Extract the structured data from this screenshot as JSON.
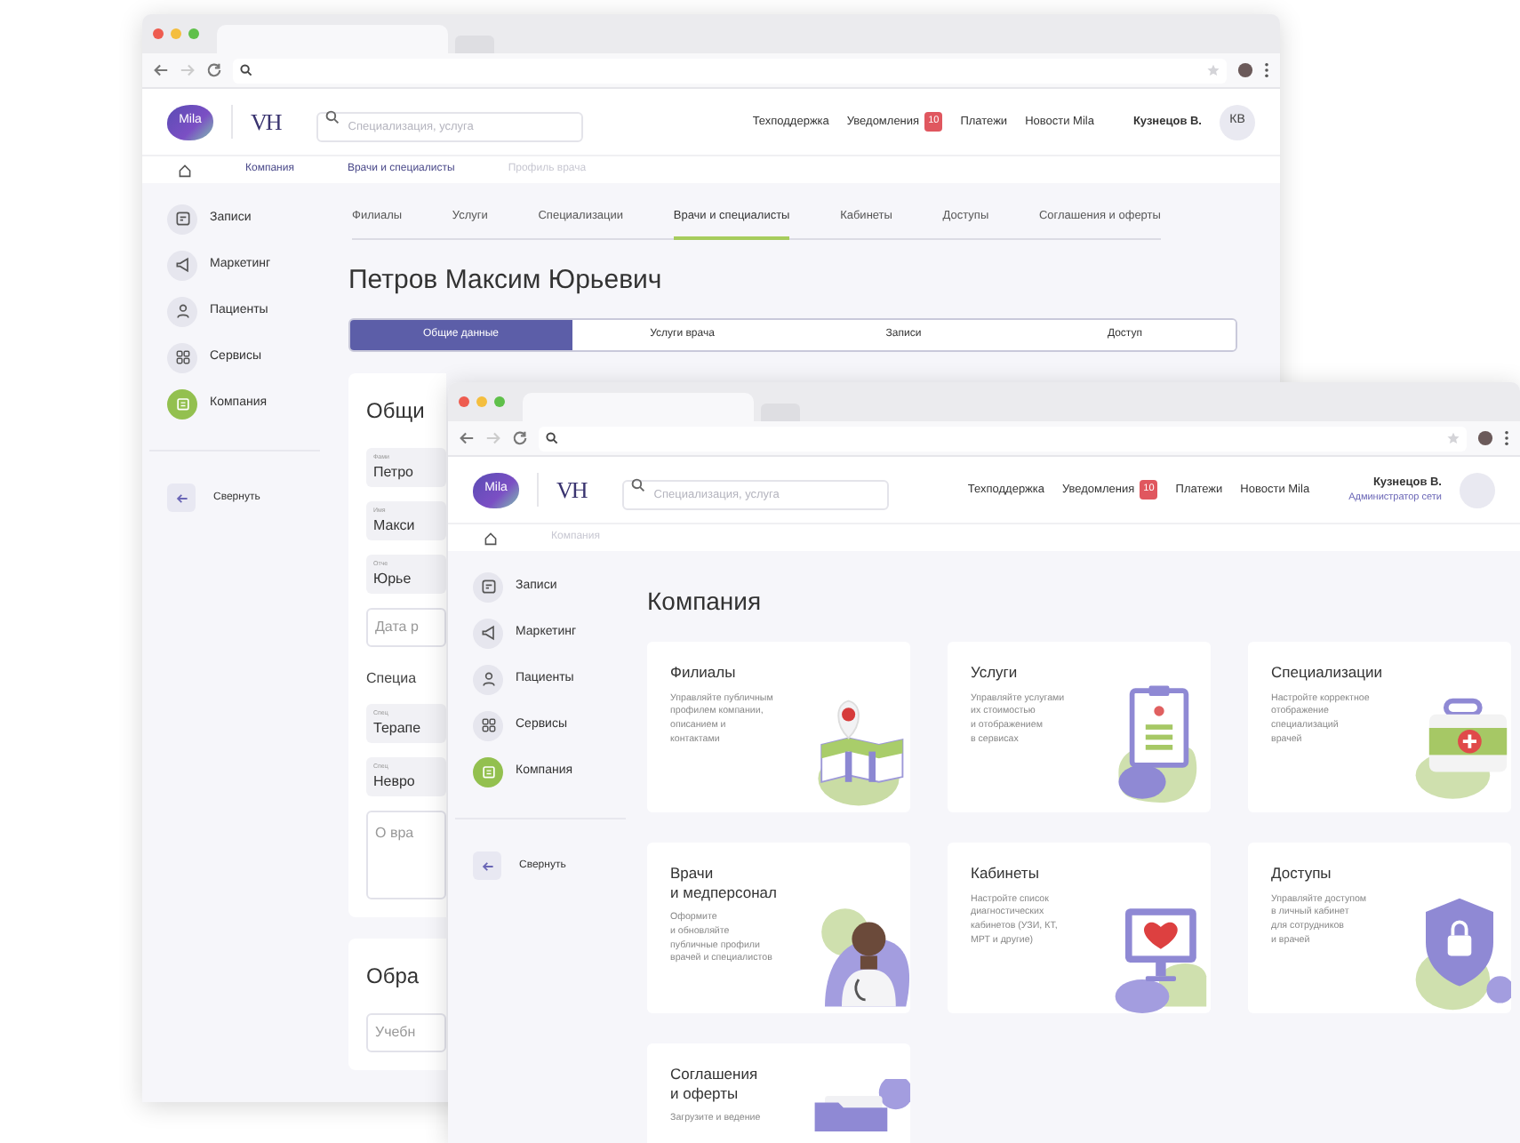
{
  "back_window": {
    "header": {
      "logo": "Mila",
      "brand": "VH",
      "search": {
        "placeholder": "Специализация, услуга"
      },
      "nav": [
        {
          "label": "Техподдержка"
        },
        {
          "label": "Уведомления",
          "badge": "10"
        },
        {
          "label": "Платежи"
        },
        {
          "label": "Новости Mila"
        }
      ],
      "user": {
        "name": "Кузнецов В.",
        "avatar": "КВ"
      }
    },
    "breadcrumbs": [
      {
        "label": "Компания",
        "disabled": false
      },
      {
        "label": "Врачи и специалисты",
        "disabled": false
      },
      {
        "label": "Профиль врача",
        "disabled": true
      }
    ],
    "sidebar": {
      "items": [
        {
          "label": "Записи",
          "selected": false
        },
        {
          "label": "Маркетинг",
          "selected": false
        },
        {
          "label": "Пациенты",
          "selected": false
        },
        {
          "label": "Сервисы",
          "selected": false
        },
        {
          "label": "Компания",
          "selected": true
        }
      ],
      "collapse": "Свернуть"
    },
    "tabs": [
      {
        "label": "Филиалы",
        "selected": false
      },
      {
        "label": "Услуги",
        "selected": false
      },
      {
        "label": "Специализации",
        "selected": false
      },
      {
        "label": "Врачи и специалисты",
        "selected": true
      },
      {
        "label": "Кабинеты",
        "selected": false
      },
      {
        "label": "Доступы",
        "selected": false
      },
      {
        "label": "Соглашения и оферты",
        "selected": false
      }
    ],
    "title": "Петров Максим Юрьевич",
    "segments": [
      {
        "label": "Общие данные",
        "selected": true
      },
      {
        "label": "Услуги врача",
        "selected": false
      },
      {
        "label": "Записи",
        "selected": false
      },
      {
        "label": "Доступ",
        "selected": false
      }
    ],
    "forms": [
      {
        "title": "Общи",
        "fields": [
          {
            "kind": "filled",
            "label": "Фами",
            "value": "Петро"
          },
          {
            "kind": "filled",
            "label": "Имя",
            "value": "Макси"
          },
          {
            "kind": "filled",
            "label": "Отче",
            "value": "Юрье"
          },
          {
            "kind": "empty",
            "placeholder": "Дата р"
          },
          {
            "kind": "heading",
            "text": "Специа"
          },
          {
            "kind": "filled",
            "label": "Спец",
            "value": "Терапе"
          },
          {
            "kind": "filled",
            "label": "Спец",
            "value": "Невро"
          },
          {
            "kind": "textarea",
            "placeholder": "О вра"
          }
        ]
      },
      {
        "title": "Обра",
        "fields": [
          {
            "kind": "empty",
            "placeholder": "Учебн"
          }
        ]
      }
    ]
  },
  "front_window": {
    "header": {
      "logo": "Mila",
      "brand": "VH",
      "search": {
        "placeholder": "Специализация, услуга"
      },
      "nav": [
        {
          "label": "Техподдержка"
        },
        {
          "label": "Уведомления",
          "badge": "10"
        },
        {
          "label": "Платежи"
        },
        {
          "label": "Новости Mila"
        }
      ],
      "user": {
        "name": "Кузнецов В.",
        "role": "Администратор сети"
      }
    },
    "breadcrumbs": [
      {
        "label": "Компания",
        "disabled": true
      }
    ],
    "sidebar": {
      "items": [
        {
          "label": "Записи",
          "selected": false
        },
        {
          "label": "Маркетинг",
          "selected": false
        },
        {
          "label": "Пациенты",
          "selected": false
        },
        {
          "label": "Сервисы",
          "selected": false
        },
        {
          "label": "Компания",
          "selected": true
        }
      ],
      "collapse": "Свернуть"
    },
    "title": "Компания",
    "cards": [
      {
        "title": "Филиалы",
        "description": "Управляйте публичным\nпрофилем компании,\nописанием и\nконтактами"
      },
      {
        "title": "Услуги",
        "description": "Управляйте услугами\nих стоимостью\nи отображением\nв сервисах"
      },
      {
        "title": "Специализации",
        "description": "Настройте корректное\nотображение\nспециализаций\nврачей"
      },
      {
        "title": "Врачи\nи медперсонал",
        "description": "Оформите\nи обновляйте\nпубличные профили\nврачей и специалистов"
      },
      {
        "title": "Кабинеты",
        "description": "Настройте список\nдиагностических\nкабинетов (УЗИ, КТ,\nМРТ и другие)"
      },
      {
        "title": "Доступы",
        "description": "Управляйте доступом\nв личный кабинет\nдля сотрудников\nи врачей"
      },
      {
        "title": "Соглашения\nи оферты",
        "description": "Загрузите и ведение"
      }
    ]
  }
}
